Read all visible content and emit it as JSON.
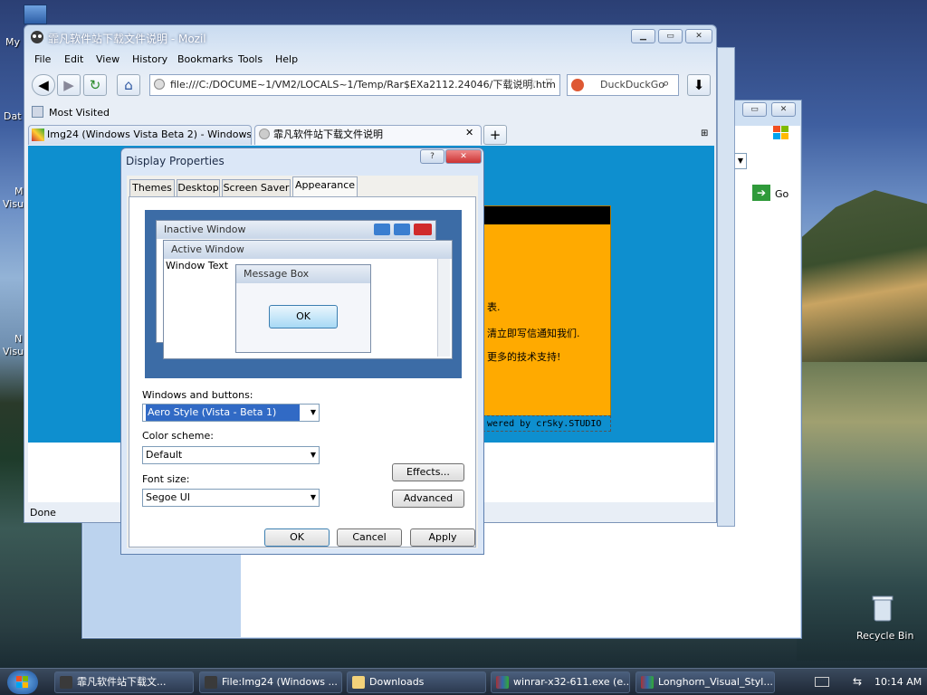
{
  "desktop": {
    "icon_labels": [
      "My",
      "Dat",
      "M",
      "Visu",
      "N",
      "Visu"
    ],
    "recycle_bin": "Recycle Bin"
  },
  "firefox": {
    "title": "霏凡软件站下载文件说明 - Mozil",
    "menu": [
      "File",
      "Edit",
      "View",
      "History",
      "Bookmarks",
      "Tools",
      "Help"
    ],
    "url": "file:///C:/DOCUME~1/VM2/LOCALS~1/Temp/Rar$EXa2112.24046/下载说明.htm",
    "search_placeholder": "DuckDuckGo",
    "bookmark": "Most Visited",
    "tabs": [
      {
        "label": "Img24 (Windows Vista Beta 2) - Windows ..."
      },
      {
        "label": "霏凡软件站下载文件说明"
      }
    ],
    "status": "Done",
    "page": {
      "lines": [
        "表.",
        "清立即写信通知我们.",
        "更多的技术支持!"
      ],
      "footer": "wered by crSky.STUDIO"
    }
  },
  "background_window": {
    "go_label": "Go"
  },
  "dialog": {
    "title": "Display Properties",
    "tabs": [
      "Themes",
      "Desktop",
      "Screen Saver",
      "Appearance"
    ],
    "preview": {
      "inactive_title": "Inactive Window",
      "active_title": "Active Window",
      "window_text": "Window Text",
      "message_title": "Message Box",
      "ok": "OK"
    },
    "windows_buttons_label": "Windows and buttons:",
    "windows_buttons_value": "Aero Style (Vista - Beta 1)",
    "color_scheme_label": "Color scheme:",
    "color_scheme_value": "Default",
    "font_size_label": "Font size:",
    "font_size_value": "Segoe UI",
    "effects": "Effects...",
    "advanced": "Advanced",
    "ok": "OK",
    "cancel": "Cancel",
    "apply": "Apply"
  },
  "taskbar": {
    "items": [
      {
        "label": "霏凡软件站下载文..."
      },
      {
        "label": "File:Img24 (Windows ..."
      },
      {
        "label": "Downloads"
      },
      {
        "label": "winrar-x32-611.exe (e..."
      },
      {
        "label": "Longhorn_Visual_Styl..."
      }
    ],
    "clock": "10:14 AM"
  },
  "colors": {
    "accent": "#0e8fcf",
    "page_yellow": "#ffaa00",
    "selection": "#316ac5"
  }
}
